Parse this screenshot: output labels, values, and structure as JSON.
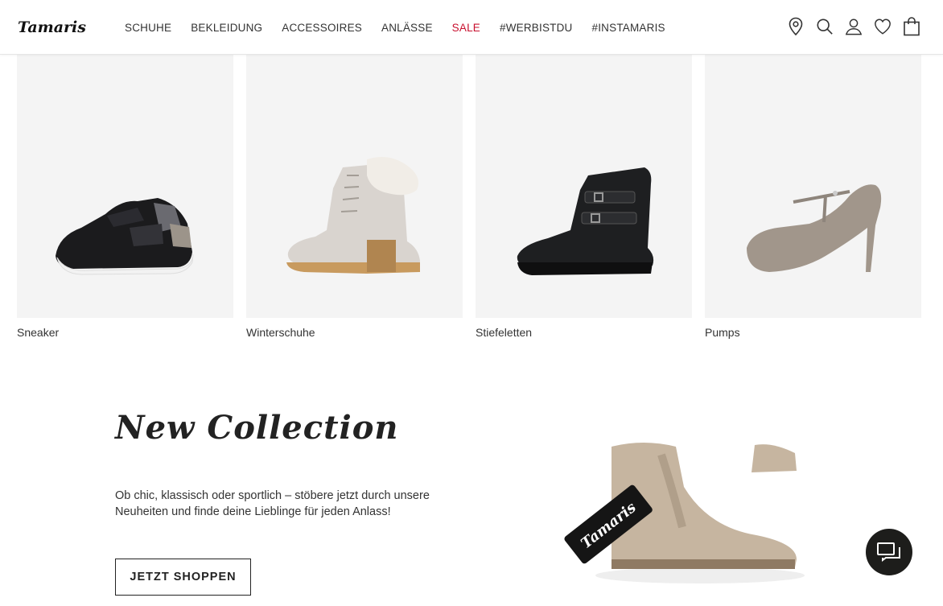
{
  "header": {
    "logo_text": "Tamaris",
    "nav": [
      {
        "label": "SCHUHE"
      },
      {
        "label": "BEKLEIDUNG"
      },
      {
        "label": "ACCESSOIRES"
      },
      {
        "label": "ANLÄSSE"
      },
      {
        "label": "SALE"
      },
      {
        "label": "#WERBISTDU"
      },
      {
        "label": "#INSTAMARIS"
      }
    ],
    "icons": [
      "store-locator-icon",
      "search-icon",
      "account-icon",
      "wishlist-icon",
      "cart-icon"
    ]
  },
  "categories": [
    {
      "label": "Sneaker"
    },
    {
      "label": "Winterschuhe"
    },
    {
      "label": "Stiefeletten"
    },
    {
      "label": "Pumps"
    }
  ],
  "new_collection": {
    "title": "New Collection",
    "text": "Ob chic, klassisch oder sportlich – stöbere jetzt durch unsere Neuheiten und finde deine Lieblinge für jeden Anlass!",
    "button": "JETZT SHOPPEN",
    "tag_text": "Tamaris"
  },
  "colors": {
    "sale": "#c8102e",
    "chat_bg": "#1d1d1b"
  }
}
